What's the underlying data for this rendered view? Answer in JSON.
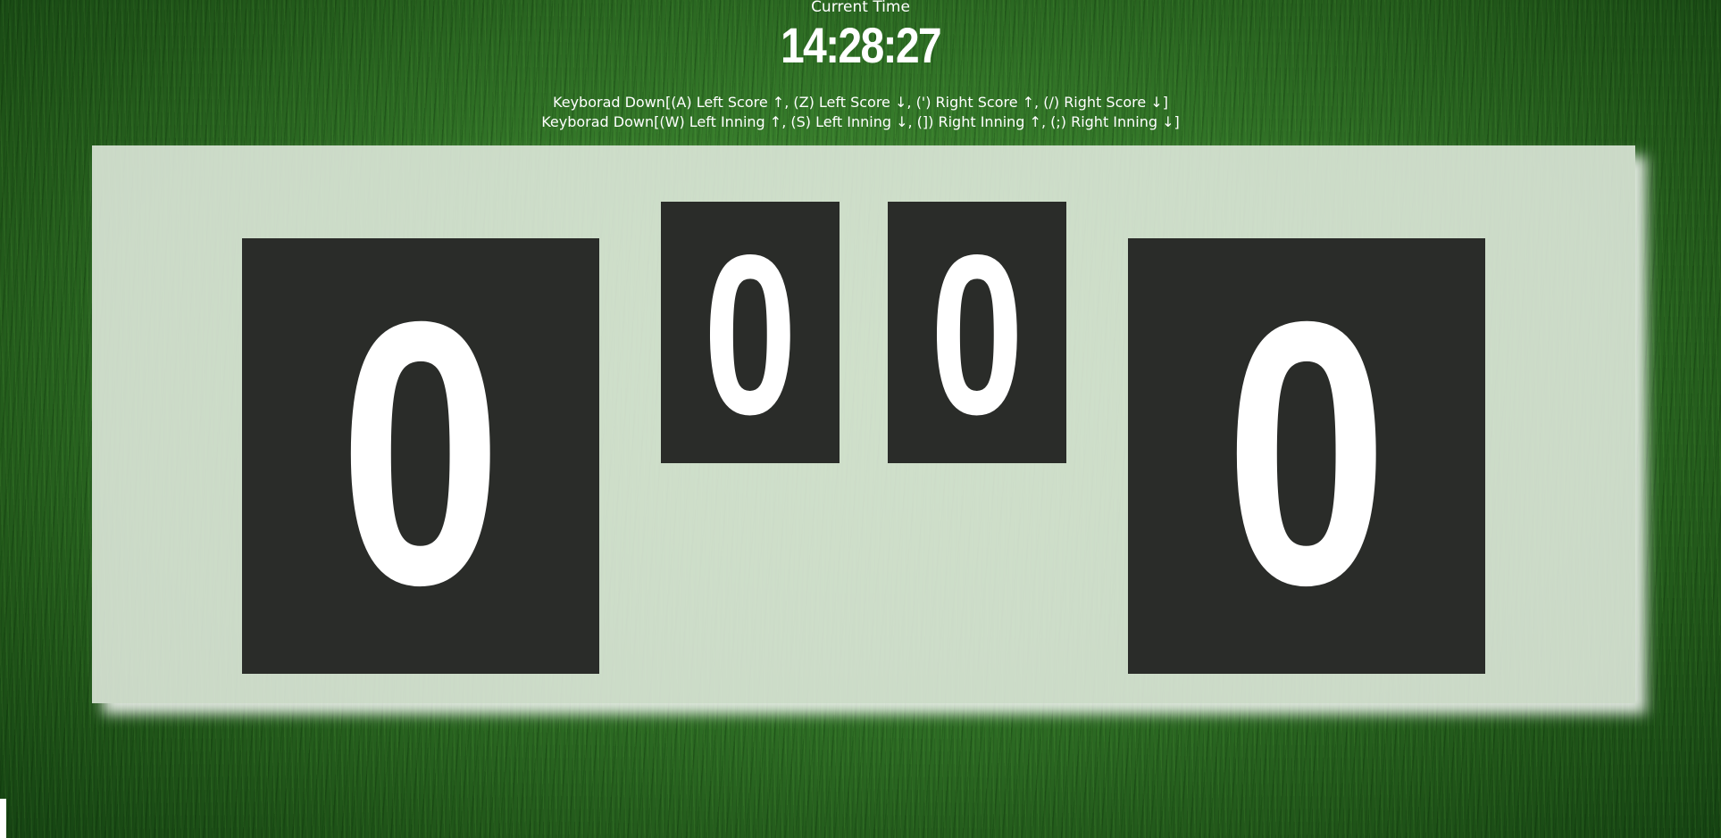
{
  "clock": {
    "label": "Current Time",
    "time": "14:28:27"
  },
  "instructions": {
    "score_line": "Keyborad Down[(A) Left Score ↑, (Z) Left Score ↓, (') Right Score ↑, (/) Right Score ↓]",
    "inning_line": "Keyborad Down[(W) Left Inning ↑, (S) Left Inning ↓, (]) Right Inning ↑, (;) Right Inning ↓]"
  },
  "scoreboard": {
    "left_score": "0",
    "left_inning": "0",
    "right_inning": "0",
    "right_score": "0"
  },
  "colors": {
    "grass": "#2f6e25",
    "board": "#dee8da",
    "card": "#2a2c29",
    "digit": "#ffffff"
  }
}
